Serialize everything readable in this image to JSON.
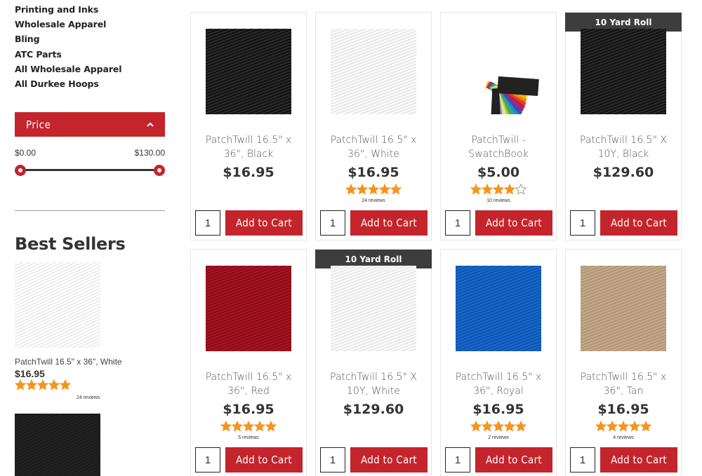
{
  "sidebar": {
    "categories": [
      {
        "label": "Printing and Inks"
      },
      {
        "label": "Wholesale Apparel"
      },
      {
        "label": "Bling"
      },
      {
        "label": "ATC Parts"
      },
      {
        "label": "All Wholesale Apparel"
      },
      {
        "label": "All Durkee Hoops"
      }
    ],
    "price_filter": {
      "title": "Price",
      "min_label": "$0.00",
      "max_label": "$130.00"
    },
    "best_sellers": {
      "title": "Best Sellers",
      "items": [
        {
          "name": "PatchTwill 16.5\" x 36\", White",
          "price": "$16.95",
          "rating": 5,
          "reviews": "24 reviews",
          "swatch": "white"
        },
        {
          "swatch": "black"
        }
      ]
    }
  },
  "products": [
    {
      "name": "PatchTwill 16.5\" x 36\", Black",
      "price": "$16.95",
      "swatch": "black",
      "badge": "",
      "rating": 0,
      "reviews": "",
      "qty": "1",
      "cta": "Add to Cart"
    },
    {
      "name": "PatchTwill 16.5\" x 36\", White",
      "price": "$16.95",
      "swatch": "white",
      "badge": "",
      "rating": 5,
      "reviews": "24 reviews",
      "qty": "1",
      "cta": "Add to Cart"
    },
    {
      "name": "PatchTwill - SwatchBook",
      "price": "$5.00",
      "swatch": "swatchbook",
      "badge": "",
      "rating": 4,
      "reviews": "10 reviews",
      "qty": "1",
      "cta": "Add to Cart"
    },
    {
      "name": "PatchTwill 16.5\" X 10Y, Black",
      "price": "$129.60",
      "swatch": "black",
      "badge": "10 Yard Roll",
      "rating": 0,
      "reviews": "",
      "qty": "1",
      "cta": "Add to Cart"
    },
    {
      "name": "PatchTwill 16.5\" x 36\", Red",
      "price": "$16.95",
      "swatch": "red",
      "badge": "",
      "rating": 5,
      "reviews": "5 reviews",
      "qty": "1",
      "cta": "Add to Cart"
    },
    {
      "name": "PatchTwill 16.5\" X 10Y, White",
      "price": "$129.60",
      "swatch": "white",
      "badge": "10 Yard Roll",
      "rating": 0,
      "reviews": "",
      "qty": "1",
      "cta": "Add to Cart"
    },
    {
      "name": "PatchTwill 16.5\" x 36\", Royal",
      "price": "$16.95",
      "swatch": "royal",
      "badge": "",
      "rating": 5,
      "reviews": "2 reviews",
      "qty": "1",
      "cta": "Add to Cart"
    },
    {
      "name": "PatchTwill 16.5\" x 36\", Tan",
      "price": "$16.95",
      "swatch": "tan",
      "badge": "",
      "rating": 5,
      "reviews": "4 reviews",
      "qty": "1",
      "cta": "Add to Cart"
    }
  ],
  "colors": {
    "accent_red": "#c4242b",
    "badge_bg": "#3d3d3d",
    "star_fill": "#f7941d"
  },
  "icons": {
    "price_toggle": "chevron-up-icon",
    "star": "star-icon"
  }
}
